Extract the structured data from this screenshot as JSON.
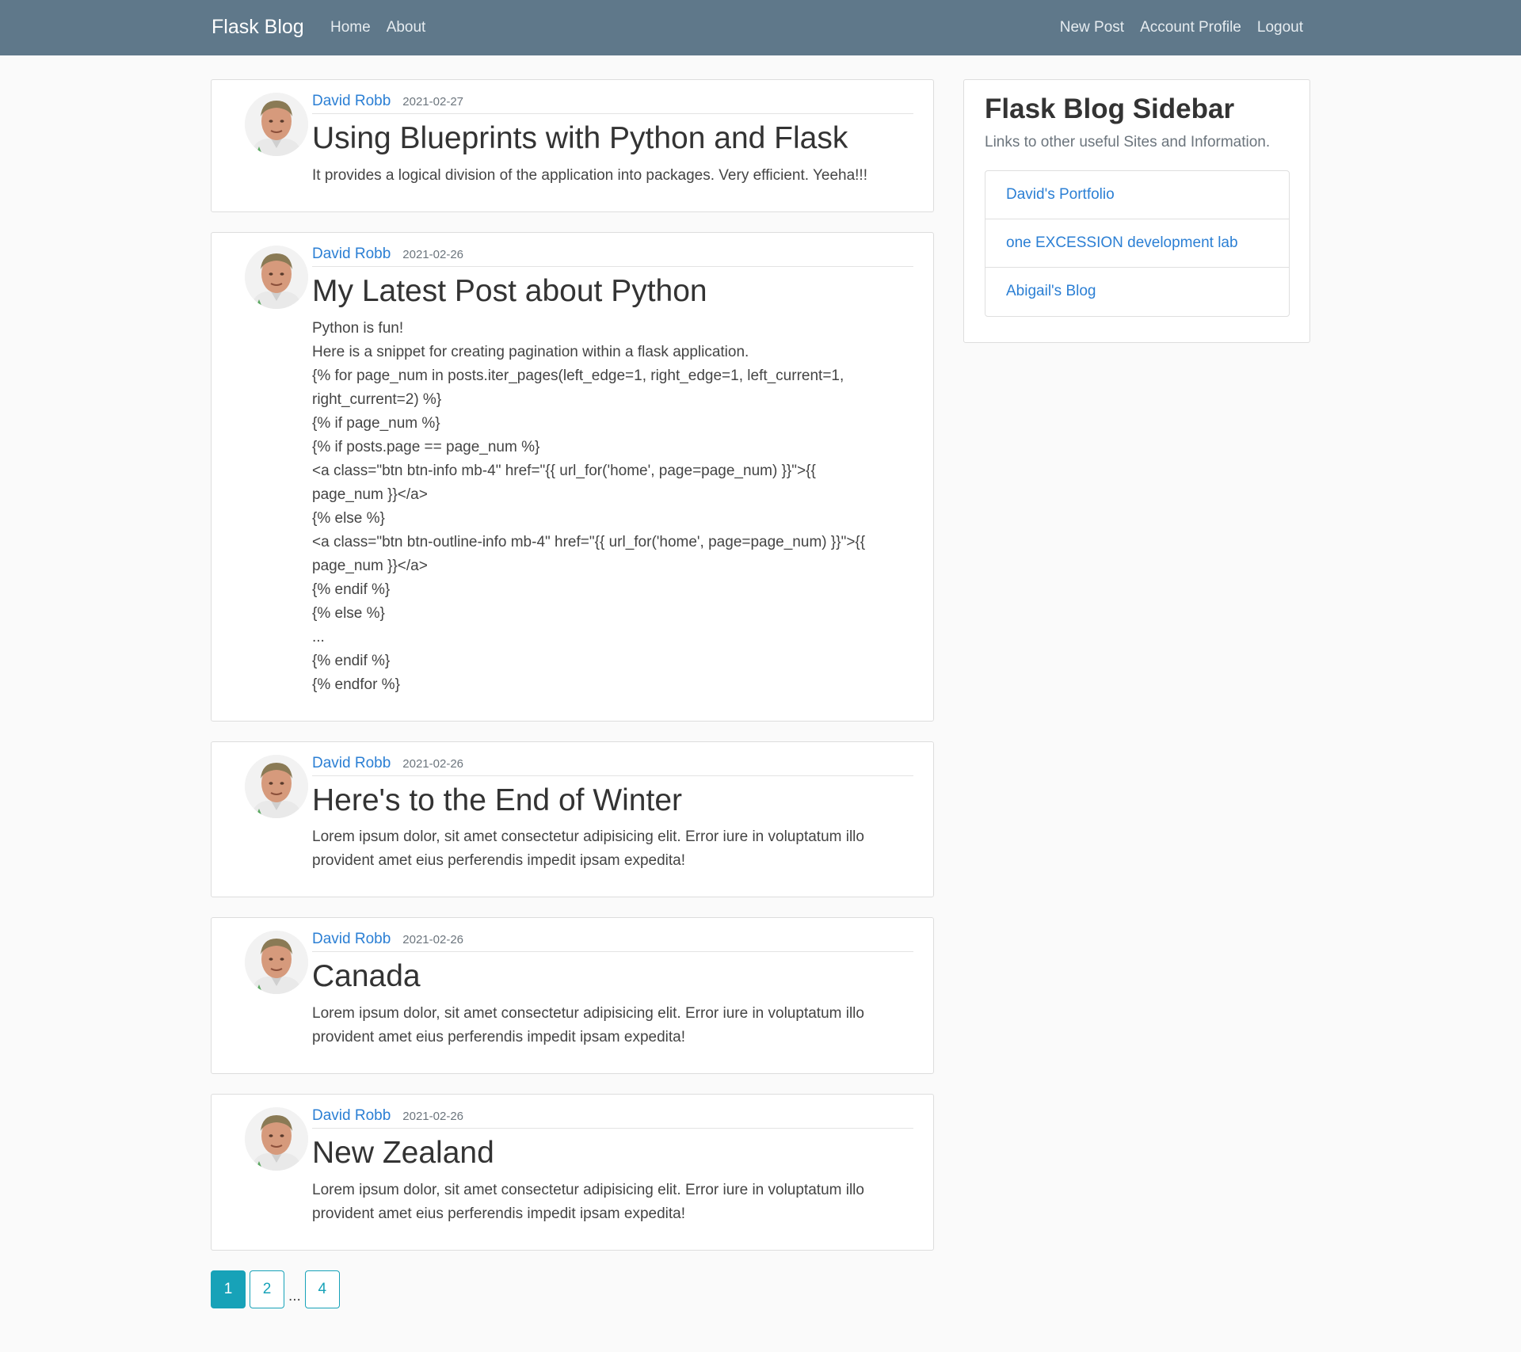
{
  "navbar": {
    "brand": "Flask Blog",
    "left_links": [
      "Home",
      "About"
    ],
    "right_links": [
      "New Post",
      "Account Profile",
      "Logout"
    ]
  },
  "posts": [
    {
      "author": "David Robb",
      "date": "2021-02-27",
      "title": "Using Blueprints with Python and Flask",
      "content": [
        "It provides a logical division of the application into packages. Very efficient. Yeeha!!!"
      ]
    },
    {
      "author": "David Robb",
      "date": "2021-02-26",
      "title": "My Latest Post about Python",
      "content": [
        "Python is fun!",
        "Here is a snippet for creating pagination within a flask application.",
        "{% for page_num in posts.iter_pages(left_edge=1, right_edge=1, left_current=1,",
        "right_current=2) %}",
        "{% if page_num %}",
        "{% if posts.page == page_num %}",
        "<a class=\"btn btn-info mb-4\" href=\"{{ url_for('home', page=page_num) }}\">{{",
        "page_num }}</a>",
        "{% else %}",
        "<a class=\"btn btn-outline-info mb-4\" href=\"{{ url_for('home', page=page_num) }}\">{{",
        "page_num }}</a>",
        "{% endif %}",
        "{% else %}",
        "...",
        "{% endif %}",
        "{% endfor %}"
      ]
    },
    {
      "author": "David Robb",
      "date": "2021-02-26",
      "title": "Here's to the End of Winter",
      "content": [
        "Lorem ipsum dolor, sit amet consectetur adipisicing elit. Error iure in voluptatum illo",
        "provident amet eius perferendis impedit ipsam expedita!"
      ]
    },
    {
      "author": "David Robb",
      "date": "2021-02-26",
      "title": "Canada",
      "content": [
        "Lorem ipsum dolor, sit amet consectetur adipisicing elit. Error iure in voluptatum illo",
        "provident amet eius perferendis impedit ipsam expedita!"
      ]
    },
    {
      "author": "David Robb",
      "date": "2021-02-26",
      "title": "New Zealand",
      "content": [
        "Lorem ipsum dolor, sit amet consectetur adipisicing elit. Error iure in voluptatum illo",
        "provident amet eius perferendis impedit ipsam expedita!"
      ]
    }
  ],
  "pagination": {
    "items": [
      {
        "label": "1",
        "type": "page",
        "active": true
      },
      {
        "label": "2",
        "type": "page",
        "active": false
      },
      {
        "label": "...",
        "type": "ellipsis",
        "active": false
      },
      {
        "label": "4",
        "type": "page",
        "active": false
      }
    ]
  },
  "sidebar": {
    "title": "Flask Blog Sidebar",
    "subtitle": "Links to other useful Sites and Information.",
    "links": [
      "David's Portfolio",
      "one EXCESSION development lab",
      "Abigail's Blog"
    ]
  },
  "colors": {
    "navbar_bg": "#5f788a",
    "link": "#2b7fd4",
    "pagination_accent": "#17a2b8",
    "page_bg": "#fafafa"
  },
  "icons": {
    "avatar": "user-avatar-photo"
  }
}
